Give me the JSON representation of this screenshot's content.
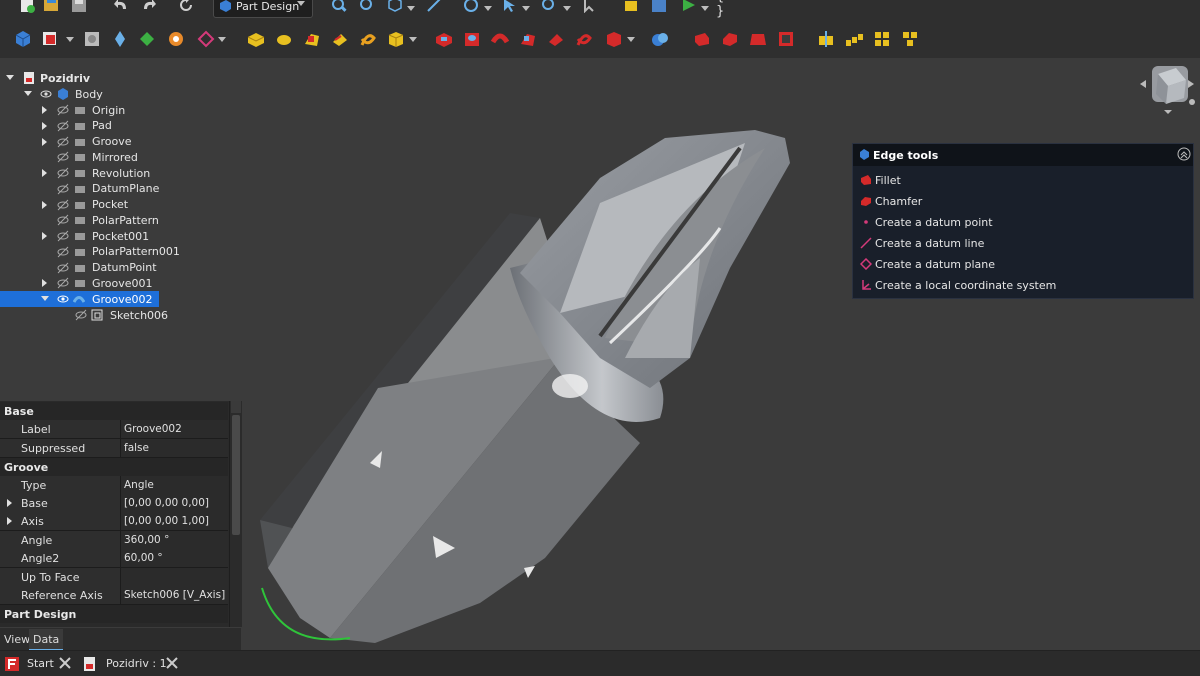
{
  "workbench": {
    "selected": "Part Design"
  },
  "tree": {
    "document": "Pozidriv",
    "body": "Body",
    "items": [
      {
        "label": "Origin",
        "expandable": true
      },
      {
        "label": "Pad",
        "expandable": true
      },
      {
        "label": "Groove",
        "expandable": true
      },
      {
        "label": "Mirrored",
        "expandable": false
      },
      {
        "label": "Revolution",
        "expandable": true
      },
      {
        "label": "DatumPlane",
        "expandable": false
      },
      {
        "label": "Pocket",
        "expandable": true
      },
      {
        "label": "PolarPattern",
        "expandable": false
      },
      {
        "label": "Pocket001",
        "expandable": true
      },
      {
        "label": "PolarPattern001",
        "expandable": false
      },
      {
        "label": "DatumPoint",
        "expandable": false
      },
      {
        "label": "Groove001",
        "expandable": true
      }
    ],
    "selected": "Groove002",
    "child": "Sketch006",
    "selection_color": "#1e6fd9"
  },
  "properties": {
    "group_base": "Base",
    "group_groove": "Groove",
    "group_part_design": "Part Design",
    "rows": [
      {
        "key": "Label",
        "value": "Groove002"
      },
      {
        "key": "Suppressed",
        "value": "false"
      },
      {
        "key": "Type",
        "value": "Angle"
      },
      {
        "key": "Base",
        "value": "[0,00 0,00 0,00]"
      },
      {
        "key": "Axis",
        "value": "[0,00 0,00 1,00]"
      },
      {
        "key": "Angle",
        "value": "360,00 °"
      },
      {
        "key": "Angle2",
        "value": "60,00 °"
      },
      {
        "key": "Up To Face",
        "value": ""
      },
      {
        "key": "Reference Axis",
        "value": "Sketch006 [V_Axis]"
      }
    ],
    "tabs": [
      "View",
      "Data"
    ],
    "active_tab": "Data"
  },
  "edge_tools": {
    "title": "Edge tools",
    "items": [
      "Fillet",
      "Chamfer",
      "Create a datum point",
      "Create a datum line",
      "Create a datum plane",
      "Create a local coordinate system"
    ]
  },
  "taskbar": {
    "tabs": [
      "Start",
      "Pozidriv : 1"
    ]
  },
  "toolbar": {
    "macro_label": "{ }"
  },
  "colors": {
    "accent": "#1e6fd9",
    "feature_red": "#d42a2a",
    "feature_yellow": "#e8c020",
    "edge_green": "#2fc43a"
  }
}
